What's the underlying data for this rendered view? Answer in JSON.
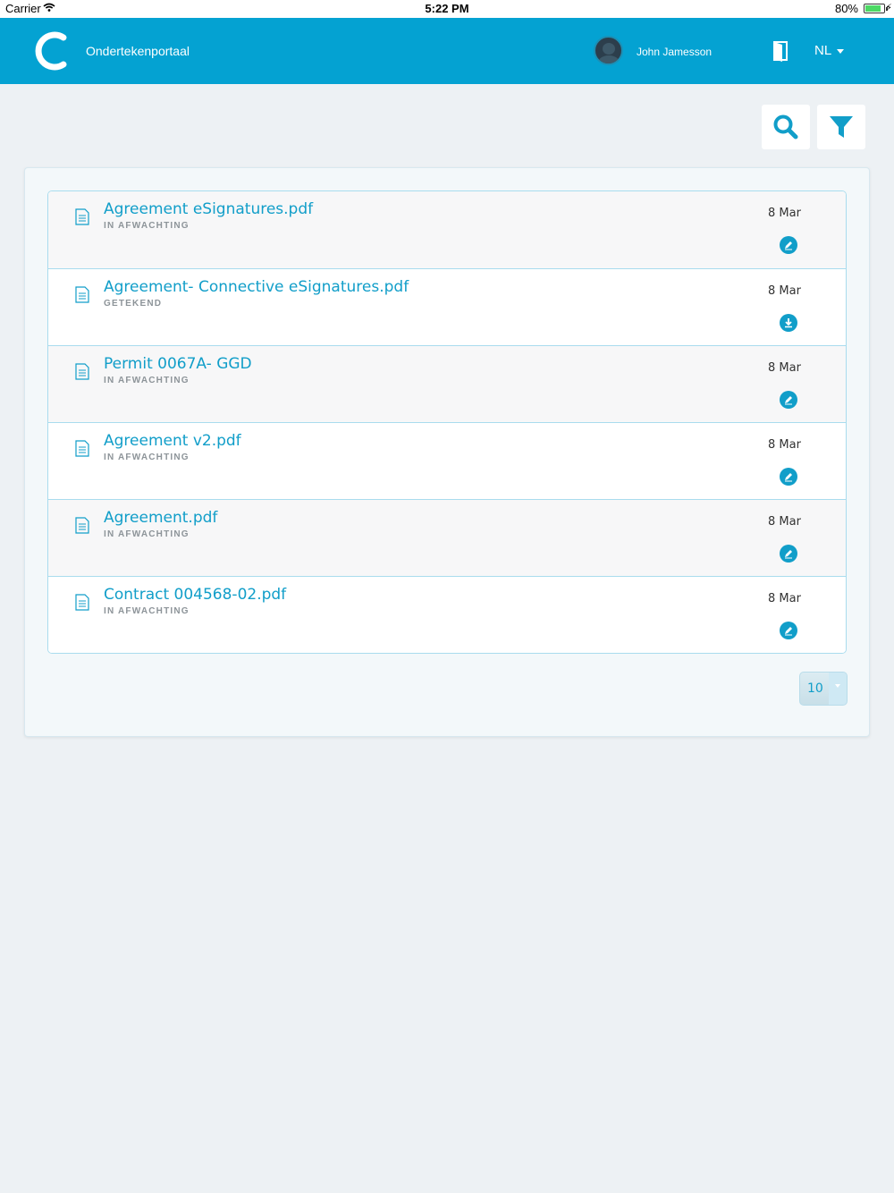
{
  "status_bar": {
    "carrier": "Carrier",
    "time": "5:22 PM",
    "battery": "80%",
    "battery_level": 0.8
  },
  "header": {
    "title": "Ondertekenportaal",
    "user_name": "John Jamesson",
    "language": "NL",
    "background_color": "#04a2d2"
  },
  "toolbar": {
    "search_icon": "search-icon",
    "filter_icon": "filter-icon"
  },
  "documents": [
    {
      "title": "Agreement eSignatures.pdf",
      "status": "IN AFWACHTING",
      "date": "8 Mar",
      "action": "sign-icon"
    },
    {
      "title": "Agreement- Connective eSignatures.pdf",
      "status": "GETEKEND",
      "date": "8 Mar",
      "action": "download-icon"
    },
    {
      "title": "Permit 0067A- GGD",
      "status": "IN AFWACHTING",
      "date": "8 Mar",
      "action": "sign-icon"
    },
    {
      "title": "Agreement v2.pdf",
      "status": "IN AFWACHTING",
      "date": "8 Mar",
      "action": "sign-icon"
    },
    {
      "title": "Agreement.pdf",
      "status": "IN AFWACHTING",
      "date": "8 Mar",
      "action": "sign-icon"
    },
    {
      "title": "Contract 004568-02.pdf",
      "status": "IN AFWACHTING",
      "date": "8 Mar",
      "action": "sign-icon"
    }
  ],
  "pagination": {
    "page_size": "10"
  },
  "accent_color": "#119ec9"
}
